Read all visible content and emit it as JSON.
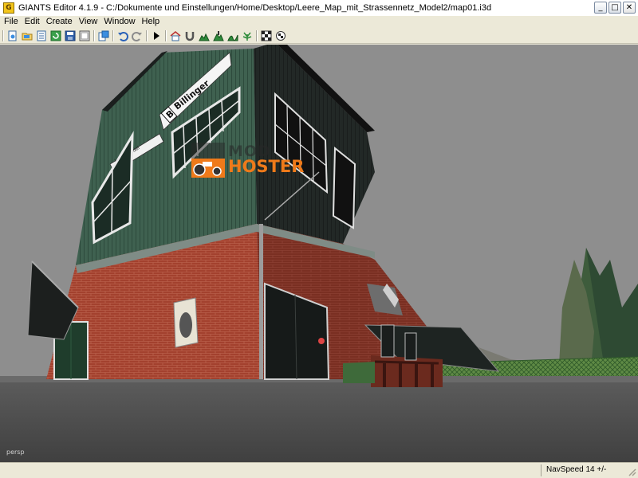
{
  "window": {
    "title": "GIANTS Editor 4.1.9 - C:/Dokumente und Einstellungen/Home/Desktop/Leere_Map_mit_Strassennetz_Model2/map01.i3d",
    "app_icon": "giants-app-icon",
    "controls": [
      {
        "name": "minimize",
        "glyph": "_"
      },
      {
        "name": "maximize",
        "glyph": "□"
      },
      {
        "name": "close",
        "glyph": "✕"
      }
    ]
  },
  "menu": {
    "items": [
      {
        "label": "File"
      },
      {
        "label": "Edit"
      },
      {
        "label": "Create"
      },
      {
        "label": "View"
      },
      {
        "label": "Window"
      },
      {
        "label": "Help"
      }
    ]
  },
  "toolbar": {
    "icons": [
      "new-icon",
      "open-icon",
      "import-icon",
      "reload-icon",
      "save-icon",
      "save-as-icon",
      "export-icon",
      "undo-icon",
      "redo-icon",
      "play-icon",
      "home-icon",
      "magnet-icon",
      "terrain-paint-icon",
      "terrain-sculpt-icon",
      "terrain-smooth-icon",
      "foliage-paint-icon",
      "checker-icon",
      "checker-settings-icon"
    ]
  },
  "viewport": {
    "camera_label": "persp",
    "scene_signs": {
      "name_sign": "Billinger",
      "logo_letter": "B",
      "small_sign": "Landhandel"
    }
  },
  "watermark": {
    "line1": "MOD",
    "line2": "HOSTER"
  },
  "statusbar": {
    "navspeed": "NavSpeed 14 +/-"
  },
  "colors": {
    "window_chrome": "#ece9d8",
    "accent_orange": "#ef7a1a",
    "sky": "#8f8f8f",
    "wall_green": "#3f6150",
    "brick": "#a6402d"
  }
}
